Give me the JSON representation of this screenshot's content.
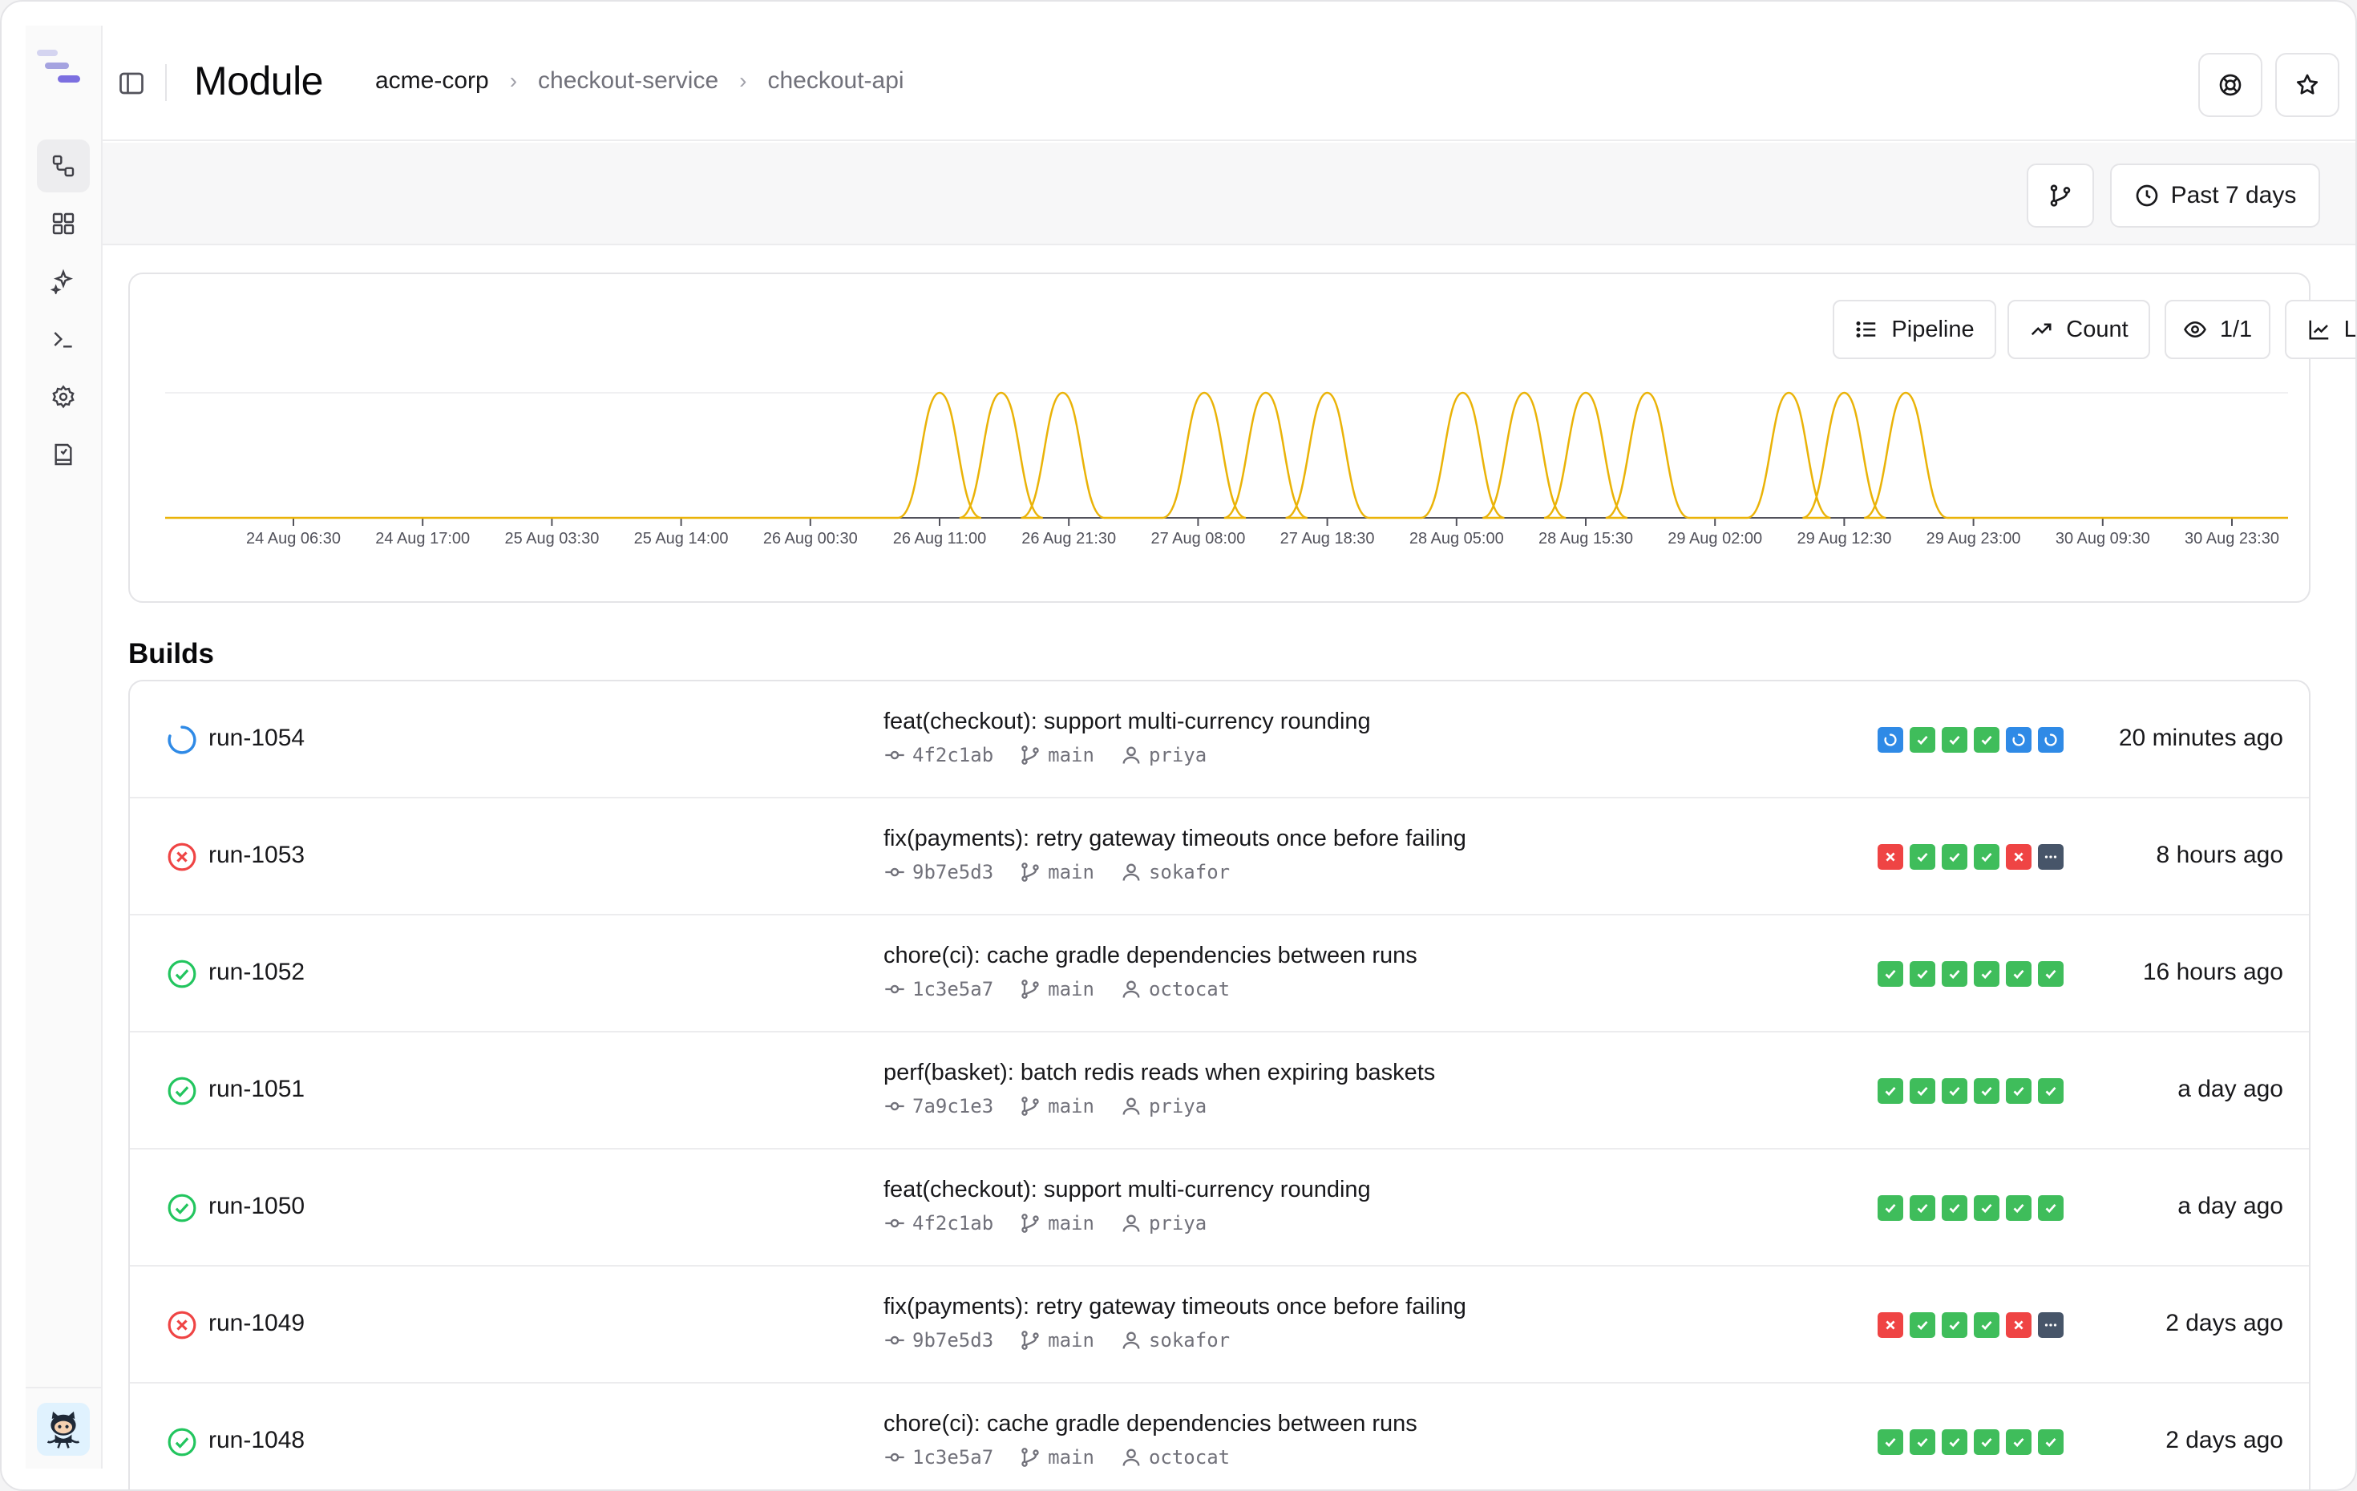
{
  "header": {
    "title": "Module",
    "breadcrumb": [
      "acme-corp",
      "checkout-service",
      "checkout-api"
    ]
  },
  "toolbar": {
    "range_label": "Past 7 days"
  },
  "chart_controls": {
    "group_label": "Pipeline",
    "metric_label": "Count",
    "visibility_label": "1/1",
    "type_label": "Line"
  },
  "chart_data": {
    "type": "line",
    "title": "",
    "xlabel": "",
    "ylabel": "",
    "line_color": "#eab308",
    "grid": "single top gridline",
    "x_ticks": [
      "24 Aug 06:30",
      "24 Aug 17:00",
      "25 Aug 03:30",
      "25 Aug 14:00",
      "26 Aug 00:30",
      "26 Aug 11:00",
      "26 Aug 21:30",
      "27 Aug 08:00",
      "27 Aug 18:30",
      "28 Aug 05:00",
      "28 Aug 15:30",
      "29 Aug 02:00",
      "29 Aug 12:30",
      "29 Aug 23:00",
      "30 Aug 09:30",
      "30 Aug 23:30"
    ],
    "ylim": [
      0,
      1
    ],
    "series": [
      {
        "peaks": [
          "26 Aug 11:00",
          "26 Aug 16:00",
          "26 Aug 21:00",
          "27 Aug 08:30",
          "27 Aug 13:30",
          "27 Aug 18:30",
          "28 Aug 05:30",
          "28 Aug 10:30",
          "28 Aug 15:30",
          "28 Aug 20:30",
          "29 Aug 08:00",
          "29 Aug 12:30",
          "29 Aug 17:30"
        ],
        "peak_value": 1
      }
    ]
  },
  "builds": {
    "title": "Builds",
    "rows": [
      {
        "run": "run-1054",
        "status": "running",
        "message": "feat(checkout): support multi-currency rounding",
        "commit": "4f2c1ab",
        "branch": "main",
        "author": "priya",
        "jobs": [
          "running",
          "success",
          "success",
          "success",
          "running",
          "running"
        ],
        "when": "20 minutes ago"
      },
      {
        "run": "run-1053",
        "status": "failed",
        "message": "fix(payments): retry gateway timeouts once before failing",
        "commit": "9b7e5d3",
        "branch": "main",
        "author": "sokafor",
        "jobs": [
          "failed",
          "success",
          "success",
          "success",
          "failed",
          "skipped"
        ],
        "when": "8 hours ago"
      },
      {
        "run": "run-1052",
        "status": "success",
        "message": "chore(ci): cache gradle dependencies between runs",
        "commit": "1c3e5a7",
        "branch": "main",
        "author": "octocat",
        "jobs": [
          "success",
          "success",
          "success",
          "success",
          "success",
          "success"
        ],
        "when": "16 hours ago"
      },
      {
        "run": "run-1051",
        "status": "success",
        "message": "perf(basket): batch redis reads when expiring baskets",
        "commit": "7a9c1e3",
        "branch": "main",
        "author": "priya",
        "jobs": [
          "success",
          "success",
          "success",
          "success",
          "success",
          "success"
        ],
        "when": "a day ago"
      },
      {
        "run": "run-1050",
        "status": "success",
        "message": "feat(checkout): support multi-currency rounding",
        "commit": "4f2c1ab",
        "branch": "main",
        "author": "priya",
        "jobs": [
          "success",
          "success",
          "success",
          "success",
          "success",
          "success"
        ],
        "when": "a day ago"
      },
      {
        "run": "run-1049",
        "status": "failed",
        "message": "fix(payments): retry gateway timeouts once before failing",
        "commit": "9b7e5d3",
        "branch": "main",
        "author": "sokafor",
        "jobs": [
          "failed",
          "success",
          "success",
          "success",
          "failed",
          "skipped"
        ],
        "when": "2 days ago"
      },
      {
        "run": "run-1048",
        "status": "success",
        "message": "chore(ci): cache gradle dependencies between runs",
        "commit": "1c3e5a7",
        "branch": "main",
        "author": "octocat",
        "jobs": [
          "success",
          "success",
          "success",
          "success",
          "success",
          "success"
        ],
        "when": "2 days ago"
      }
    ]
  },
  "icons": {
    "sidebar": [
      "pipelines-icon",
      "dashboard-icon",
      "sparkles-icon",
      "terminal-icon",
      "settings-icon",
      "docs-icon"
    ],
    "status_colors": {
      "success": "#22c55e",
      "failed": "#ef4444",
      "running": "#2f8ae6",
      "skipped": "#475569"
    }
  }
}
